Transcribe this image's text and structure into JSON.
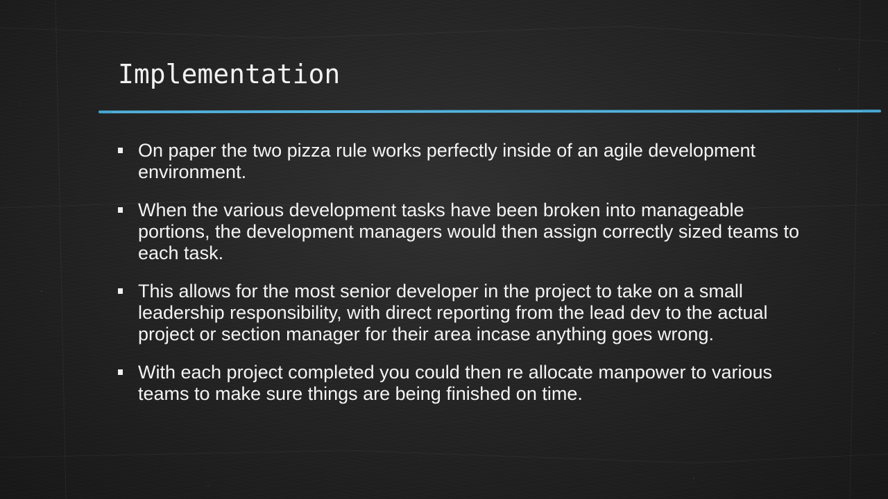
{
  "slide": {
    "title": "Implementation",
    "accent_color": "#4db8e8",
    "background_color": "#242424",
    "text_color": "#f4f4f4",
    "bullet_icon": "square-bullet-icon",
    "bullets": [
      {
        "text": "On paper the two pizza rule works perfectly inside of an agile development environment."
      },
      {
        "text": "When the various development tasks have been broken into manageable portions, the development managers would then assign correctly sized teams to each task."
      },
      {
        "text": "This allows for the most senior developer in the project to take on a small leadership responsibility, with direct reporting from the lead dev to the actual project or section manager for their area incase anything goes wrong."
      },
      {
        "text": "With each project completed you could then re allocate manpower to various teams to make sure things are being finished on time."
      }
    ]
  }
}
